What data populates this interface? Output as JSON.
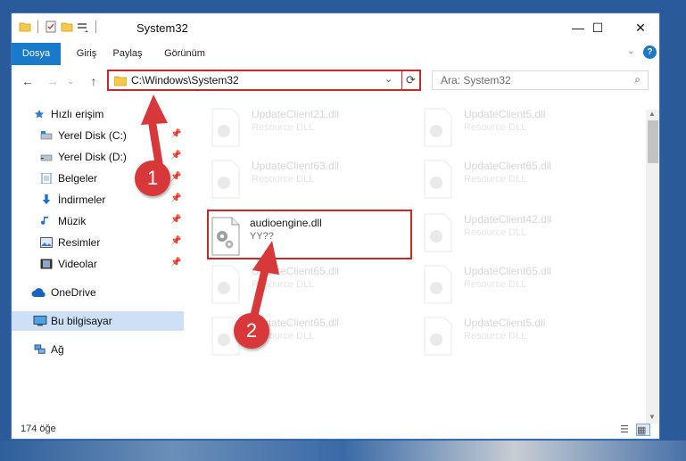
{
  "window": {
    "title": "System32",
    "controls": {
      "minimize": "—",
      "maximize": "☐",
      "close": "✕"
    }
  },
  "ribbon": {
    "tabs": [
      "Dosya",
      "Giriş",
      "Paylaş",
      "Görünüm"
    ],
    "help_icon": "?"
  },
  "address": {
    "path": "C:\\Windows\\System32",
    "search_placeholder": "Ara: System32"
  },
  "sidebar": {
    "items": [
      {
        "label": "Hızlı erişim",
        "icon": "star-icon",
        "pinned": false
      },
      {
        "label": "Yerel Disk (C:)",
        "icon": "drive-icon",
        "pinned": true
      },
      {
        "label": "Yerel Disk (D:)",
        "icon": "drive-icon",
        "pinned": true
      },
      {
        "label": "Belgeler",
        "icon": "documents-icon",
        "pinned": true
      },
      {
        "label": "İndirmeler",
        "icon": "download-icon",
        "pinned": true
      },
      {
        "label": "Müzik",
        "icon": "music-icon",
        "pinned": true
      },
      {
        "label": "Resimler",
        "icon": "pictures-icon",
        "pinned": true
      },
      {
        "label": "Videolar",
        "icon": "videos-icon",
        "pinned": true
      },
      {
        "label": "OneDrive",
        "icon": "cloud-icon",
        "pinned": false
      },
      {
        "label": "Bu bilgisayar",
        "icon": "computer-icon",
        "pinned": false
      },
      {
        "label": "Ağ",
        "icon": "network-icon",
        "pinned": false
      }
    ]
  },
  "files": [
    {
      "name": "UpdateClient21.dll",
      "type": "Resource DLL"
    },
    {
      "name": "UpdateClient5.dll",
      "type": "Resource DLL"
    },
    {
      "name": "UpdateClient63.dll",
      "type": "Resource DLL"
    },
    {
      "name": "UpdateClient65.dll",
      "type": "Resource DLL"
    },
    {
      "name": "audioengine.dll",
      "type": "YY??"
    },
    {
      "name": "UpdateClient42.dll",
      "type": "Resource DLL"
    },
    {
      "name": "UpdateClient65.dll",
      "type": "Resource DLL"
    },
    {
      "name": "UpdateClient65.dll",
      "type": "Resource DLL"
    },
    {
      "name": "UpdateClient65.dll",
      "type": "Resource DLL"
    },
    {
      "name": "UpdateClient5.dll",
      "type": "Resource DLL"
    }
  ],
  "status": {
    "item_count": "174 öğe"
  },
  "annotations": {
    "step1": "1",
    "step2": "2"
  },
  "colors": {
    "highlight": "#cc2727",
    "accent": "#1979ca",
    "badge": "#d9383a"
  }
}
